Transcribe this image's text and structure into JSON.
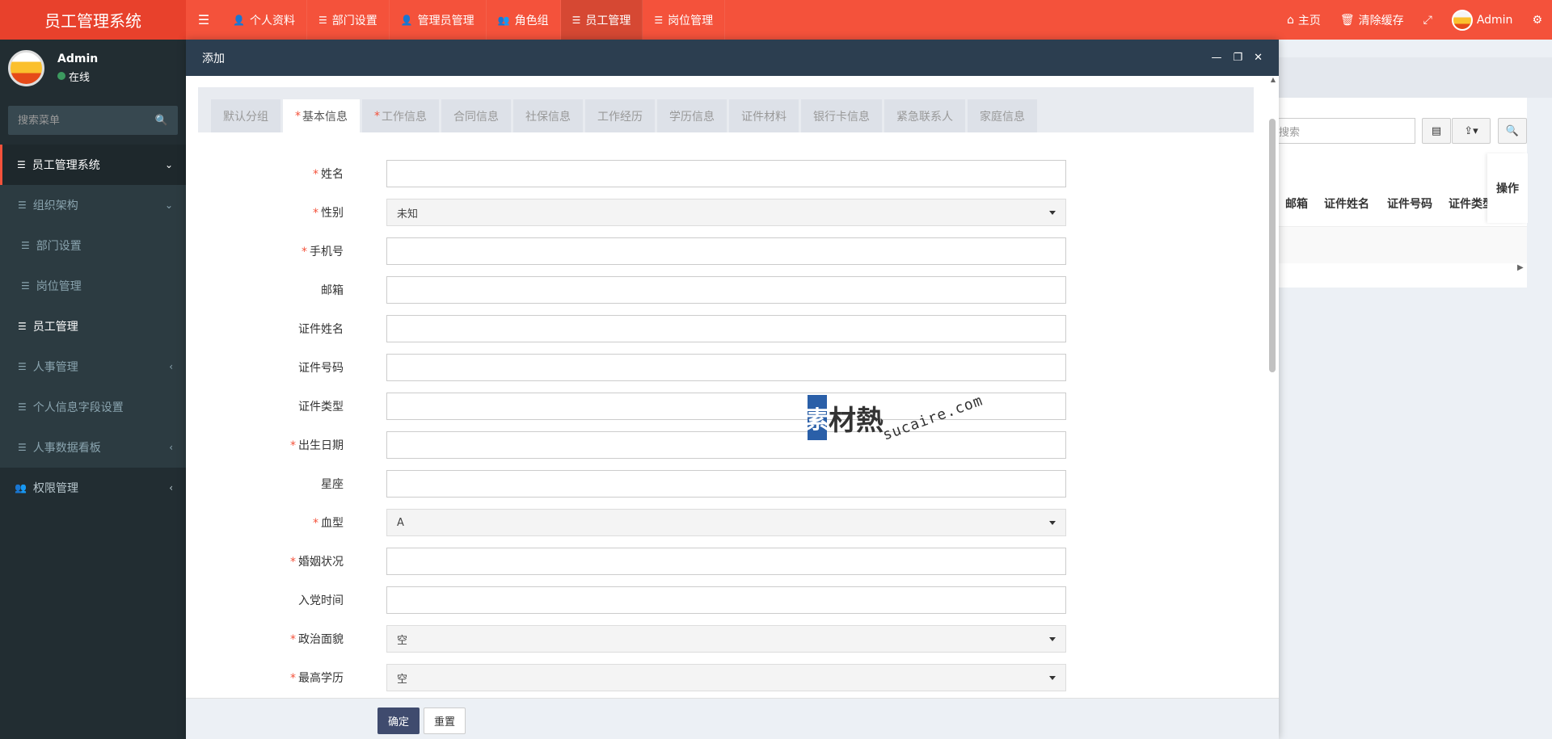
{
  "app": {
    "brand": "员工管理系统"
  },
  "topnav": {
    "items": [
      {
        "label": "个人资料",
        "icon": "user-icon"
      },
      {
        "label": "部门设置",
        "icon": "list-icon"
      },
      {
        "label": "管理员管理",
        "icon": "user-icon"
      },
      {
        "label": "角色组",
        "icon": "users-icon"
      },
      {
        "label": "员工管理",
        "icon": "list-icon",
        "active": true
      },
      {
        "label": "岗位管理",
        "icon": "list-icon"
      }
    ],
    "right": {
      "home": "主页",
      "clear_cache": "清除缓存",
      "user": "Admin"
    }
  },
  "sidebar": {
    "user": {
      "name": "Admin",
      "status": "在线"
    },
    "search_placeholder": "搜索菜单",
    "items": [
      {
        "label": "员工管理系统",
        "level": 0
      },
      {
        "label": "组织架构",
        "level": 1
      },
      {
        "label": "部门设置",
        "level": 2
      },
      {
        "label": "岗位管理",
        "level": 2
      },
      {
        "label": "员工管理",
        "level": 1,
        "current": true
      },
      {
        "label": "人事管理",
        "level": 1
      },
      {
        "label": "个人信息字段设置",
        "level": 1
      },
      {
        "label": "人事数据看板",
        "level": 1
      },
      {
        "label": "权限管理",
        "level": 0
      }
    ]
  },
  "background": {
    "search_placeholder": "搜索",
    "operation_header": "操作",
    "table_headers": [
      "邮箱",
      "证件姓名",
      "证件号码",
      "证件类型"
    ]
  },
  "modal": {
    "title": "添加",
    "tabs": [
      {
        "label": "默认分组",
        "required": false
      },
      {
        "label": "基本信息",
        "required": true,
        "active": true
      },
      {
        "label": "工作信息",
        "required": true
      },
      {
        "label": "合同信息",
        "required": false
      },
      {
        "label": "社保信息",
        "required": false
      },
      {
        "label": "工作经历",
        "required": false
      },
      {
        "label": "学历信息",
        "required": false
      },
      {
        "label": "证件材料",
        "required": false
      },
      {
        "label": "银行卡信息",
        "required": false
      },
      {
        "label": "紧急联系人",
        "required": false
      },
      {
        "label": "家庭信息",
        "required": false
      }
    ],
    "fields": [
      {
        "label": "姓名",
        "required": true,
        "type": "text",
        "value": ""
      },
      {
        "label": "性别",
        "required": true,
        "type": "select",
        "value": "未知"
      },
      {
        "label": "手机号",
        "required": true,
        "type": "text",
        "value": ""
      },
      {
        "label": "邮箱",
        "required": false,
        "type": "text",
        "value": ""
      },
      {
        "label": "证件姓名",
        "required": false,
        "type": "text",
        "value": ""
      },
      {
        "label": "证件号码",
        "required": false,
        "type": "text",
        "value": ""
      },
      {
        "label": "证件类型",
        "required": false,
        "type": "text",
        "value": ""
      },
      {
        "label": "出生日期",
        "required": true,
        "type": "text",
        "value": ""
      },
      {
        "label": "星座",
        "required": false,
        "type": "text",
        "value": ""
      },
      {
        "label": "血型",
        "required": true,
        "type": "select",
        "value": "A"
      },
      {
        "label": "婚姻状况",
        "required": true,
        "type": "text",
        "value": ""
      },
      {
        "label": "入党时间",
        "required": false,
        "type": "text",
        "value": ""
      },
      {
        "label": "政治面貌",
        "required": true,
        "type": "select",
        "value": "空"
      },
      {
        "label": "最高学历",
        "required": true,
        "type": "select",
        "value": "空"
      }
    ],
    "ok_label": "确定",
    "reset_label": "重置"
  },
  "watermark": {
    "logo_text": "素材熱",
    "url": "sucaire.com"
  },
  "colors": {
    "topbar": "#f4523b",
    "sidebar": "#222d32",
    "modal_header": "#2c3e50",
    "required": "#f4523b",
    "primary_button": "#3f4b6e"
  }
}
